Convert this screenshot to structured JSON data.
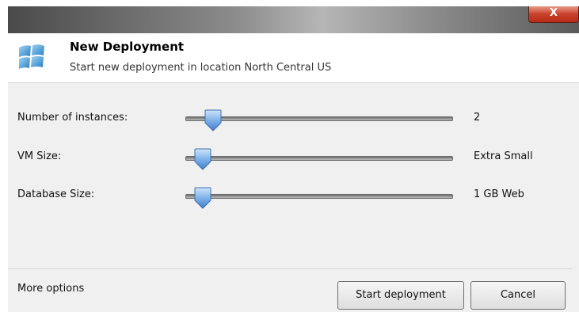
{
  "window": {
    "close_label": "X"
  },
  "header": {
    "title": "New Deployment",
    "subtitle": "Start new deployment in location North Central US",
    "logo_icon": "windows-azure-logo"
  },
  "settings": [
    {
      "label": "Number of instances:",
      "value": "2",
      "slider_position": 0.12
    },
    {
      "label": "VM Size:",
      "value": "Extra Small",
      "slider_position": 0.06
    },
    {
      "label": "Database Size:",
      "value": "1 GB Web",
      "slider_position": 0.06
    }
  ],
  "footer": {
    "more_options": "More options",
    "start_button": "Start deployment",
    "cancel_button": "Cancel"
  },
  "colors": {
    "close_button": "#c8412b",
    "slider_thumb": "#4f8fd8",
    "body_background": "#f0f0f0"
  }
}
